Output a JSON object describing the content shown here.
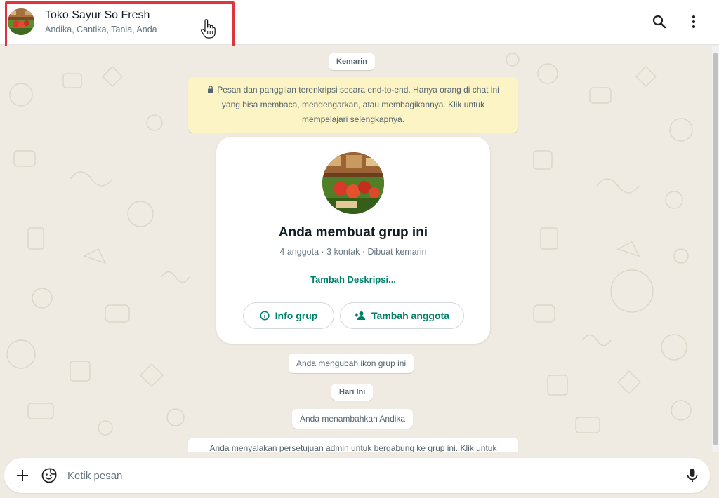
{
  "header": {
    "group_name": "Toko Sayur So Fresh",
    "members": "Andika, Cantika, Tania, Anda",
    "search_icon": "search-icon",
    "menu_icon": "kebab-menu-icon"
  },
  "chat": {
    "date_yesterday": "Kemarin",
    "encryption_notice": "Pesan dan panggilan terenkripsi secara end-to-end. Hanya orang di chat ini yang bisa membaca, mendengarkan, atau membagikannya. Klik untuk mempelajari selengkapnya.",
    "group_card": {
      "title": "Anda membuat grup ini",
      "subtitle": "4 anggota · 3 kontak · Dibuat kemarin",
      "add_description": "Tambah Deskripsi...",
      "info_button": "Info grup",
      "add_member_button": "Tambah anggota"
    },
    "system_changed_icon": "Anda mengubah ikon grup ini",
    "date_today": "Hari Ini",
    "system_added": "Anda menambahkan Andika",
    "system_admin_approval": "Anda menyalakan persetujuan admin untuk bergabung ke grup ini. Klik untuk"
  },
  "composer": {
    "placeholder": "Ketik pesan",
    "attach_icon": "plus-icon",
    "sticker_icon": "sticker-icon",
    "mic_icon": "microphone-icon"
  },
  "colors": {
    "accent": "#008069",
    "chat_background": "#efeae2",
    "encryption_bg": "#fdf4c5",
    "highlight": "#e0333b"
  }
}
